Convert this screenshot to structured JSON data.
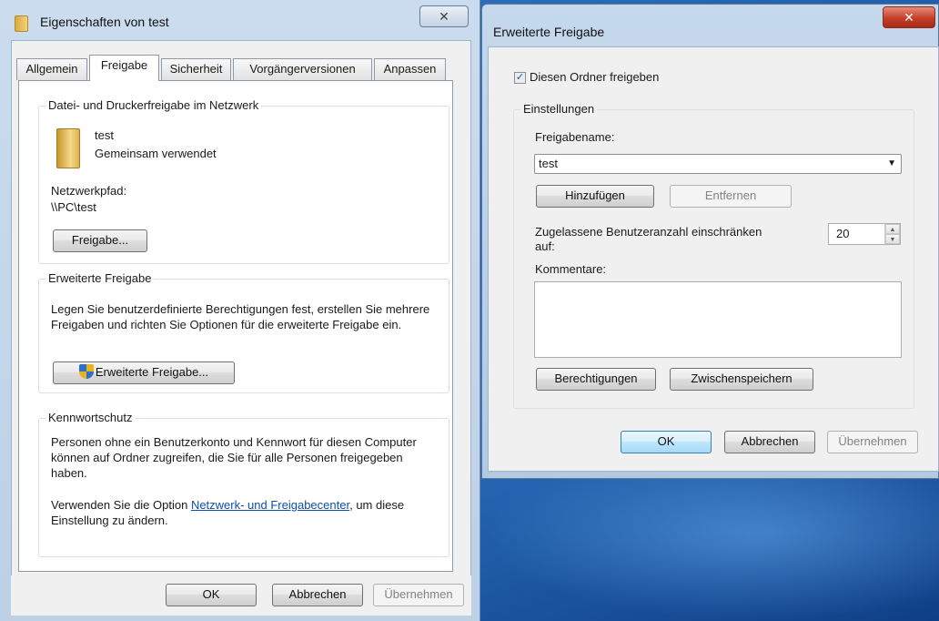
{
  "props_window": {
    "title": "Eigenschaften von test",
    "close_glyph": "✕",
    "tabs": [
      "Allgemein",
      "Freigabe",
      "Sicherheit",
      "Vorgängerversionen",
      "Anpassen"
    ],
    "active_tab": "Freigabe",
    "network_share": {
      "group_title": "Datei- und Druckerfreigabe im Netzwerk",
      "folder_name": "test",
      "folder_status": "Gemeinsam verwendet",
      "path_label": "Netzwerkpfad:",
      "path_value": "\\\\PC\\test",
      "share_button": "Freigabe..."
    },
    "advanced": {
      "group_title": "Erweiterte Freigabe",
      "description": "Legen Sie benutzerdefinierte Berechtigungen fest, erstellen Sie mehrere Freigaben und richten Sie Optionen für die erweiterte Freigabe ein.",
      "button": "Erweiterte Freigabe..."
    },
    "password": {
      "group_title": "Kennwortschutz",
      "description": "Personen ohne ein Benutzerkonto und Kennwort für diesen Computer können auf Ordner zugreifen, die Sie für alle Personen freigegeben haben.",
      "hint_before": "Verwenden Sie die Option ",
      "hint_link": "Netzwerk- und Freigabecenter",
      "hint_after": ", um diese Einstellung zu ändern."
    },
    "buttons": {
      "ok": "OK",
      "cancel": "Abbrechen",
      "apply": "Übernehmen"
    }
  },
  "adv_window": {
    "title": "Erweiterte Freigabe",
    "close_glyph": "✕",
    "share_checkbox": {
      "label": "Diesen Ordner freigeben",
      "checked": true,
      "check_glyph": "✓"
    },
    "settings": {
      "group_title": "Einstellungen",
      "name_label": "Freigabename:",
      "name_value": "test",
      "add_button": "Hinzufügen",
      "remove_button": "Entfernen",
      "limit_label_line1": "Zugelassene Benutzeranzahl einschränken",
      "limit_label_line2": "auf:",
      "limit_value": "20",
      "comments_label": "Kommentare:",
      "comments_value": "",
      "permissions_button": "Berechtigungen",
      "caching_button": "Zwischenspeichern"
    },
    "buttons": {
      "ok": "OK",
      "cancel": "Abbrechen",
      "apply": "Übernehmen"
    }
  }
}
